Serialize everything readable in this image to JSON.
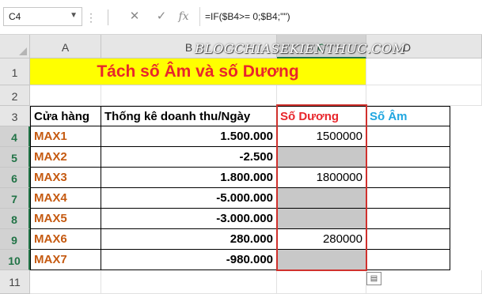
{
  "name_box": "C4",
  "formula_bar": {
    "cancel_icon": "x-icon",
    "enter_icon": "check-icon",
    "function_icon": "fx-icon",
    "function_label": "fx",
    "formula": "=IF($B4>= 0;$B4;\"\")"
  },
  "watermark": "BLOGCHIASEKIENTHUC.COM",
  "columns": [
    "A",
    "B",
    "C",
    "D"
  ],
  "rows": [
    "1",
    "2",
    "3",
    "4",
    "5",
    "6",
    "7",
    "8",
    "9",
    "10",
    "11"
  ],
  "title": "Tách số Âm và số Dương",
  "headers": {
    "store": "Cửa hàng",
    "revenue": "Thống kê doanh thu/Ngày",
    "positive": "Số Dương",
    "negative": "Số Âm"
  },
  "data": [
    {
      "store": "MAX1",
      "revenue": "1.500.000",
      "positive": "1500000"
    },
    {
      "store": "MAX2",
      "revenue": "-2.500",
      "positive": ""
    },
    {
      "store": "MAX3",
      "revenue": "1.800.000",
      "positive": "1800000"
    },
    {
      "store": "MAX4",
      "revenue": "-5.000.000",
      "positive": ""
    },
    {
      "store": "MAX5",
      "revenue": "-3.000.000",
      "positive": ""
    },
    {
      "store": "MAX6",
      "revenue": "280.000",
      "positive": "280000"
    },
    {
      "store": "MAX7",
      "revenue": "-980.000",
      "positive": ""
    }
  ],
  "colors": {
    "title_bg": "#ffff00",
    "title_text": "#e8262c",
    "store_text": "#c55a11",
    "positive_header": "#e8262c",
    "negative_header": "#1fa6e0",
    "empty_result_bg": "#c8c8c8",
    "selection_border": "#d0312d"
  },
  "quick_analysis_icon": "quick-analysis-icon"
}
